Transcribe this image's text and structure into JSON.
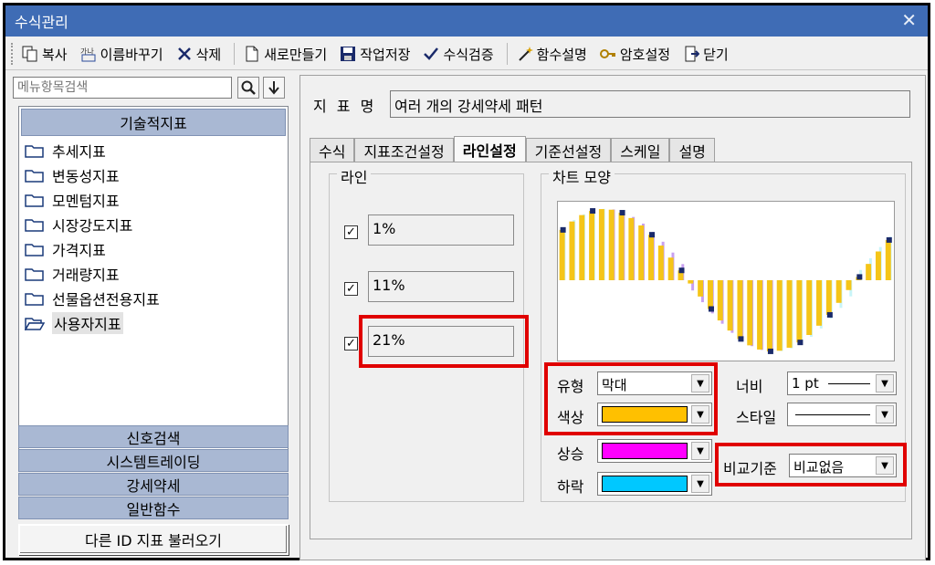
{
  "window": {
    "title": "수식관리",
    "close_symbol": "✕"
  },
  "toolbar": {
    "copy": "복사",
    "rename": "이름바꾸기",
    "delete": "삭제",
    "new": "새로만들기",
    "save": "작업저장",
    "verify": "수식검증",
    "func_desc": "함수설명",
    "password": "암호설정",
    "close": "닫기"
  },
  "left": {
    "search_placeholder": "메뉴항목검색",
    "header": "기술적지표",
    "items": [
      "추세지표",
      "변동성지표",
      "모멘텀지표",
      "시장강도지표",
      "가격지표",
      "거래량지표",
      "선물옵션전용지표",
      "사용자지표"
    ],
    "categories": [
      "신호검색",
      "시스템트레이딩",
      "강세약세",
      "일반함수"
    ],
    "load_button": "다른 ID 지표 불러오기"
  },
  "right": {
    "name_label": "지 표 명",
    "name_value": "여러 개의 강세약세 패턴",
    "tabs": [
      "수식",
      "지표조건설정",
      "라인설정",
      "기준선설정",
      "스케일",
      "설명"
    ],
    "active_tab": "라인설정",
    "line_group": {
      "legend": "라인",
      "lines": [
        {
          "checked": "✓",
          "value": "1%"
        },
        {
          "checked": "✓",
          "value": "11%"
        },
        {
          "checked": "✓",
          "value": "21%"
        }
      ]
    },
    "chart_group": {
      "legend": "차트 모양",
      "type_label": "유형",
      "type_value": "막대",
      "color_label": "색상",
      "up_label": "상승",
      "down_label": "하락",
      "width_label": "너비",
      "width_value": "1 pt",
      "style_label": "스타일",
      "compare_label": "비교기준",
      "compare_value": "비교없음",
      "colors": {
        "main": "#ffc000",
        "up": "#ff00ff",
        "down": "#00c8ff",
        "preview_main": "#f5c518",
        "preview_up": "#c8a0f0",
        "preview_down": "#c8f4f8",
        "preview_marker": "#1a2a6a"
      }
    }
  }
}
